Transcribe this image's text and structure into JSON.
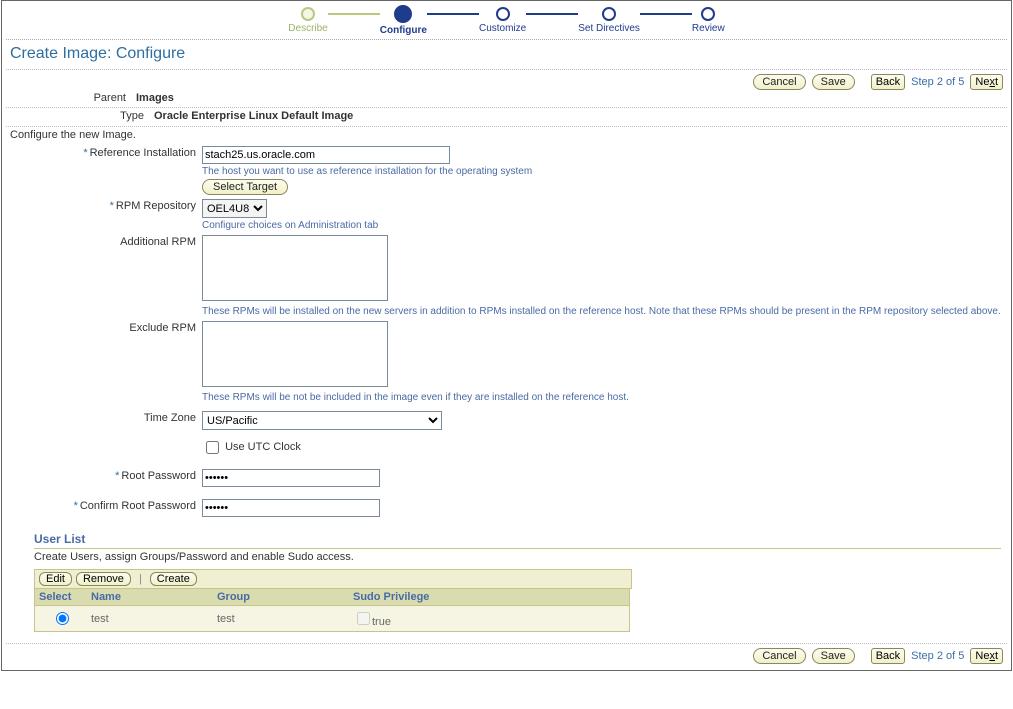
{
  "wizard_steps": {
    "describe": "Describe",
    "configure": "Configure",
    "customize": "Customize",
    "set_directives": "Set Directives",
    "review": "Review"
  },
  "page": {
    "title": "Create Image: Configure"
  },
  "buttons": {
    "cancel": "Cancel",
    "save": "Save",
    "back": "Back",
    "next_prefix": "Ne",
    "next_ak": "x",
    "next_suffix": "t",
    "step_text": "Step 2 of 5",
    "select_target": "Select Target",
    "edit": "Edit",
    "remove": "Remove",
    "create": "Create"
  },
  "header": {
    "parent_label": "Parent",
    "parent_value": "Images",
    "type_label": "Type",
    "type_value": "Oracle Enterprise Linux Default Image"
  },
  "instruct": "Configure the new Image.",
  "form": {
    "ref_install_label": "Reference Installation",
    "ref_install_value": "stach25.us.oracle.com",
    "ref_install_hint": "The host you want to use as reference installation for the operating system",
    "rpm_repo_label": "RPM Repository",
    "rpm_repo_value": "OEL4U8",
    "rpm_repo_hint": "Configure choices on Administration tab",
    "add_rpm_label": "Additional RPM",
    "add_rpm_hint": "These RPMs will be installed on the new servers in addition to RPMs installed on the reference host. Note that these RPMs should be present in the RPM repository selected above.",
    "excl_rpm_label": "Exclude RPM",
    "excl_rpm_hint": "These RPMs will be not be included in the image even if they are installed on the reference host.",
    "tz_label": "Time Zone",
    "tz_value": "US/Pacific",
    "utc_label": "Use UTC Clock",
    "root_pw_label": "Root Password",
    "root_pw_value": "••••••",
    "conf_pw_label": "Confirm Root Password",
    "conf_pw_value": "••••••"
  },
  "user_list": {
    "title": "User List",
    "desc": "Create Users, assign Groups/Password and enable Sudo access.",
    "cols": {
      "select": "Select",
      "name": "Name",
      "group": "Group",
      "sudo": "Sudo Privilege"
    },
    "rows": [
      {
        "name": "test",
        "group": "test",
        "sudo": "true"
      }
    ]
  }
}
